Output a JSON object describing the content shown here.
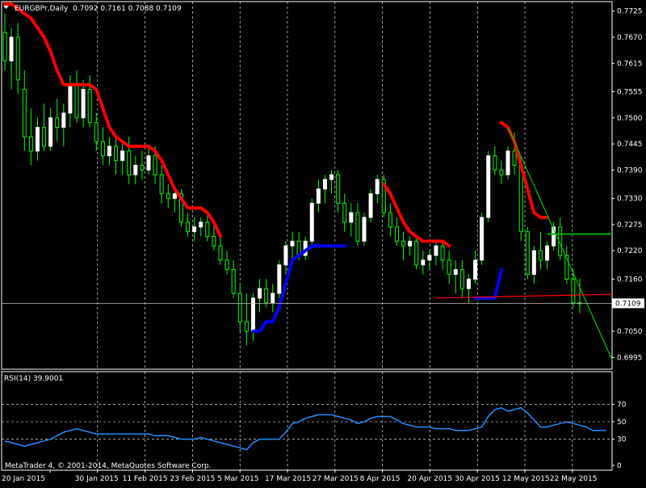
{
  "window": {
    "title": "EURGBPr,Daily",
    "ohlc": "0.7092 0.7161 0.7088 0.7109",
    "rsi_label": "RSI(14) 39.9001",
    "copyright": "MetaTrader 4, © 2001-2014, MetaQuotes Software Corp.",
    "current_price": "0.7109"
  },
  "colors": {
    "background": "#000000",
    "bull_candle": "#ffffff",
    "bear_candle": "#00ff00",
    "wick": "#00ff00",
    "stop_up": "#0000ff",
    "stop_down": "#ff0000",
    "trendline": "#00c800",
    "support_line": "#ff0000",
    "resistance_line": "#00aa00",
    "rsi_line": "#1e90ff",
    "grid": "#ffffff"
  },
  "chart_data": [
    {
      "type": "candlestick",
      "ylim": [
        0.697,
        0.7745
      ],
      "y_ticks": [
        "0.7725",
        "0.7670",
        "0.7615",
        "0.7555",
        "0.7500",
        "0.7445",
        "0.7390",
        "0.7330",
        "0.7275",
        "0.7220",
        "0.7160",
        "0.7105",
        "0.7050",
        "0.6995"
      ],
      "x_labels": [
        "20 Jan 2015",
        "30 Jan 2015",
        "11 Feb 2015",
        "23 Feb 2015",
        "5 Mar 2015",
        "17 Mar 2015",
        "27 Mar 2015",
        "8 Apr 2015",
        "20 Apr 2015",
        "30 Apr 2015",
        "12 May 2015",
        "22 May 2015"
      ],
      "candles": [
        [
          0.768,
          0.772,
          0.76,
          0.762
        ],
        [
          0.762,
          0.769,
          0.756,
          0.767
        ],
        [
          0.767,
          0.77,
          0.755,
          0.758
        ],
        [
          0.756,
          0.76,
          0.743,
          0.746
        ],
        [
          0.746,
          0.752,
          0.74,
          0.743
        ],
        [
          0.743,
          0.75,
          0.741,
          0.748
        ],
        [
          0.748,
          0.753,
          0.743,
          0.744
        ],
        [
          0.744,
          0.752,
          0.743,
          0.75
        ],
        [
          0.75,
          0.754,
          0.745,
          0.748
        ],
        [
          0.748,
          0.753,
          0.744,
          0.751
        ],
        [
          0.751,
          0.759,
          0.748,
          0.757
        ],
        [
          0.757,
          0.76,
          0.749,
          0.75
        ],
        [
          0.75,
          0.758,
          0.748,
          0.756
        ],
        [
          0.756,
          0.759,
          0.748,
          0.749
        ],
        [
          0.749,
          0.751,
          0.743,
          0.745
        ],
        [
          0.745,
          0.748,
          0.74,
          0.742
        ],
        [
          0.742,
          0.746,
          0.74,
          0.744
        ],
        [
          0.744,
          0.746,
          0.738,
          0.741
        ],
        [
          0.741,
          0.745,
          0.738,
          0.743
        ],
        [
          0.743,
          0.746,
          0.736,
          0.738
        ],
        [
          0.738,
          0.742,
          0.736,
          0.74
        ],
        [
          0.74,
          0.743,
          0.737,
          0.739
        ],
        [
          0.739,
          0.744,
          0.738,
          0.742
        ],
        [
          0.742,
          0.744,
          0.736,
          0.738
        ],
        [
          0.738,
          0.74,
          0.732,
          0.734
        ],
        [
          0.734,
          0.736,
          0.731,
          0.733
        ],
        [
          0.733,
          0.735,
          0.73,
          0.734
        ],
        [
          0.734,
          0.735,
          0.727,
          0.728
        ],
        [
          0.728,
          0.73,
          0.725,
          0.726
        ],
        [
          0.726,
          0.729,
          0.724,
          0.727
        ],
        [
          0.727,
          0.729,
          0.725,
          0.728
        ],
        [
          0.728,
          0.73,
          0.724,
          0.725
        ],
        [
          0.725,
          0.728,
          0.722,
          0.723
        ],
        [
          0.723,
          0.725,
          0.719,
          0.72
        ],
        [
          0.72,
          0.722,
          0.717,
          0.718
        ],
        [
          0.718,
          0.72,
          0.712,
          0.713
        ],
        [
          0.713,
          0.715,
          0.705,
          0.707
        ],
        [
          0.707,
          0.713,
          0.702,
          0.705
        ],
        [
          0.705,
          0.713,
          0.703,
          0.712
        ],
        [
          0.712,
          0.716,
          0.709,
          0.714
        ],
        [
          0.714,
          0.716,
          0.71,
          0.711
        ],
        [
          0.711,
          0.715,
          0.709,
          0.713
        ],
        [
          0.713,
          0.72,
          0.712,
          0.719
        ],
        [
          0.719,
          0.724,
          0.717,
          0.723
        ],
        [
          0.723,
          0.726,
          0.72,
          0.724
        ],
        [
          0.724,
          0.726,
          0.72,
          0.721
        ],
        [
          0.721,
          0.725,
          0.72,
          0.724
        ],
        [
          0.724,
          0.733,
          0.723,
          0.732
        ],
        [
          0.732,
          0.737,
          0.73,
          0.735
        ],
        [
          0.735,
          0.738,
          0.732,
          0.737
        ],
        [
          0.737,
          0.739,
          0.734,
          0.738
        ],
        [
          0.738,
          0.739,
          0.73,
          0.732
        ],
        [
          0.732,
          0.734,
          0.726,
          0.728
        ],
        [
          0.728,
          0.732,
          0.725,
          0.73
        ],
        [
          0.73,
          0.732,
          0.723,
          0.724
        ],
        [
          0.724,
          0.73,
          0.723,
          0.729
        ],
        [
          0.729,
          0.735,
          0.728,
          0.734
        ],
        [
          0.734,
          0.738,
          0.732,
          0.737
        ],
        [
          0.737,
          0.738,
          0.729,
          0.73
        ],
        [
          0.73,
          0.732,
          0.725,
          0.727
        ],
        [
          0.727,
          0.729,
          0.723,
          0.724
        ],
        [
          0.724,
          0.726,
          0.72,
          0.723
        ],
        [
          0.723,
          0.725,
          0.721,
          0.724
        ],
        [
          0.724,
          0.725,
          0.718,
          0.719
        ],
        [
          0.719,
          0.722,
          0.717,
          0.72
        ],
        [
          0.72,
          0.722,
          0.718,
          0.721
        ],
        [
          0.721,
          0.724,
          0.719,
          0.723
        ],
        [
          0.723,
          0.724,
          0.718,
          0.72
        ],
        [
          0.72,
          0.722,
          0.715,
          0.717
        ],
        [
          0.717,
          0.72,
          0.713,
          0.718
        ],
        [
          0.718,
          0.72,
          0.712,
          0.714
        ],
        [
          0.714,
          0.717,
          0.711,
          0.716
        ],
        [
          0.716,
          0.722,
          0.715,
          0.72
        ],
        [
          0.72,
          0.73,
          0.719,
          0.729
        ],
        [
          0.729,
          0.743,
          0.728,
          0.742
        ],
        [
          0.742,
          0.744,
          0.738,
          0.739
        ],
        [
          0.739,
          0.741,
          0.736,
          0.738
        ],
        [
          0.738,
          0.744,
          0.737,
          0.743
        ],
        [
          0.743,
          0.747,
          0.738,
          0.74
        ],
        [
          0.74,
          0.742,
          0.724,
          0.726
        ],
        [
          0.726,
          0.727,
          0.716,
          0.717
        ],
        [
          0.717,
          0.723,
          0.715,
          0.722
        ],
        [
          0.722,
          0.726,
          0.718,
          0.72
        ],
        [
          0.72,
          0.724,
          0.718,
          0.723
        ],
        [
          0.723,
          0.728,
          0.722,
          0.727
        ],
        [
          0.727,
          0.729,
          0.72,
          0.721
        ],
        [
          0.721,
          0.723,
          0.715,
          0.716
        ],
        [
          0.716,
          0.718,
          0.71,
          0.711
        ],
        [
          0.711,
          0.7161,
          0.7088,
          0.7109
        ]
      ],
      "stop_down_segments": [
        {
          "x_start": 0,
          "values": [
            0.774,
            0.774,
            0.773,
            0.772,
            0.771,
            0.769,
            0.767,
            0.764,
            0.76,
            0.757,
            0.757,
            0.757,
            0.757,
            0.757,
            0.756,
            0.752,
            0.748,
            0.746,
            0.745,
            0.744,
            0.744,
            0.744,
            0.744,
            0.743,
            0.741,
            0.738,
            0.735,
            0.733,
            0.731,
            0.731,
            0.731,
            0.73,
            0.728,
            0.725
          ]
        },
        {
          "x_start": 58,
          "values": [
            0.736,
            0.734,
            0.731,
            0.728,
            0.726,
            0.725,
            0.724,
            0.724,
            0.724,
            0.724,
            0.723
          ]
        },
        {
          "x_start": 76,
          "values": [
            0.749,
            0.748,
            0.745,
            0.74,
            0.735,
            0.73,
            0.729,
            0.729
          ]
        }
      ],
      "stop_up_segments": [
        {
          "x_start": 38,
          "values": [
            0.705,
            0.705,
            0.707,
            0.707,
            0.71,
            0.715,
            0.72,
            0.721,
            0.722,
            0.723,
            0.723,
            0.723,
            0.723,
            0.723,
            0.723
          ]
        },
        {
          "x_start": 72,
          "values": [
            0.712,
            0.712,
            0.712,
            0.712,
            0.718
          ]
        }
      ],
      "trend_lines": [
        {
          "name": "resistance-trendline",
          "from": [
            77,
            0.748
          ],
          "to": [
            93,
            0.699
          ]
        },
        {
          "name": "support-line",
          "from": [
            66,
            0.712
          ],
          "to": [
            94,
            0.7128
          ]
        },
        {
          "name": "horizontal-resistance",
          "from": [
            83,
            0.7255
          ],
          "to": [
            94,
            0.7255
          ]
        }
      ],
      "current_price_value": 0.7109
    },
    {
      "type": "line",
      "name": "RSI(14)",
      "ylim": [
        0,
        100
      ],
      "levels": [
        70,
        50,
        30
      ],
      "y_ticks": [
        "70",
        "50",
        "30",
        "0"
      ],
      "values": [
        28,
        26,
        24,
        22,
        24,
        26,
        28,
        30,
        34,
        38,
        40,
        42,
        40,
        38,
        36,
        36,
        36,
        36,
        36,
        36,
        36,
        36,
        36,
        34,
        34,
        34,
        32,
        30,
        30,
        30,
        32,
        30,
        28,
        26,
        24,
        22,
        20,
        18,
        26,
        30,
        30,
        30,
        30,
        38,
        48,
        50,
        54,
        56,
        58,
        58,
        58,
        56,
        54,
        52,
        48,
        50,
        54,
        56,
        56,
        56,
        52,
        48,
        46,
        44,
        44,
        44,
        42,
        42,
        42,
        40,
        40,
        40,
        42,
        44,
        56,
        64,
        66,
        62,
        64,
        66,
        60,
        52,
        44,
        44,
        46,
        48,
        50,
        48,
        46,
        44,
        40,
        40,
        40
      ]
    }
  ]
}
